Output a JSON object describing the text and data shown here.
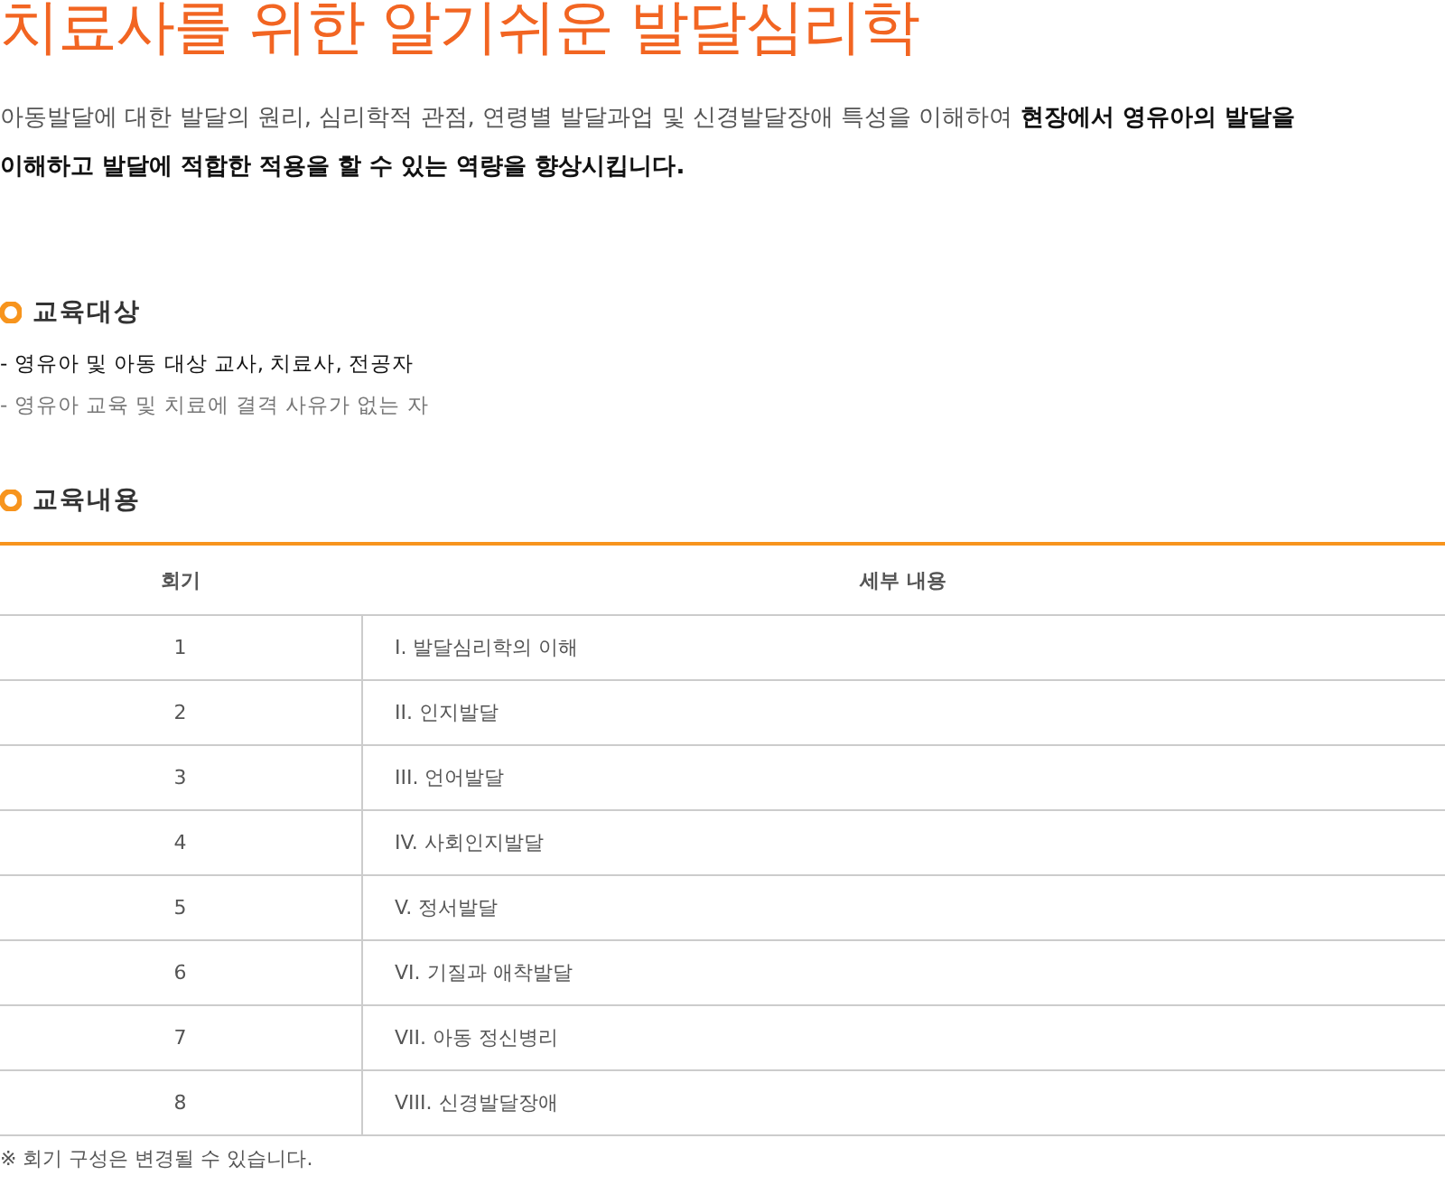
{
  "title": "치료사를 위한 알기쉬운 발달심리학",
  "intro": "아동발달에 대한 발달의 원리, 심리학적 관점, 연령별 발달과업 및 신경발달장애 특성을 이해하여 **현장에서 영유아의 발달을 이해하고 발달에 적합한 적용을 할 수 있는 역량을 향상시킵니다.**",
  "target_section": {
    "heading": "교육대상",
    "items": [
      {
        "text": "- 영유아 및 아동 대상 교사, 치료사, 전공자",
        "highlighted": true
      },
      {
        "text": "- 영유아 교육 및 치료에 결격 사유가 없는 자",
        "highlighted": false
      }
    ]
  },
  "content_section": {
    "heading": "교육내용",
    "table": {
      "columns": [
        "회기",
        "세부 내용"
      ],
      "rows": [
        [
          "1",
          "I. 발달심리학의 이해"
        ],
        [
          "2",
          "II. 인지발달"
        ],
        [
          "3",
          "III. 언어발달"
        ],
        [
          "4",
          "IV. 사회인지발달"
        ],
        [
          "5",
          "V. 정서발달"
        ],
        [
          "6",
          "VI. 기질과 애착발달"
        ],
        [
          "7",
          "VII. 아동 정신병리"
        ],
        [
          "8",
          "VIII. 신경발달장애"
        ]
      ]
    },
    "note": "※ 회기 구성은 변경될 수 있습니다."
  }
}
